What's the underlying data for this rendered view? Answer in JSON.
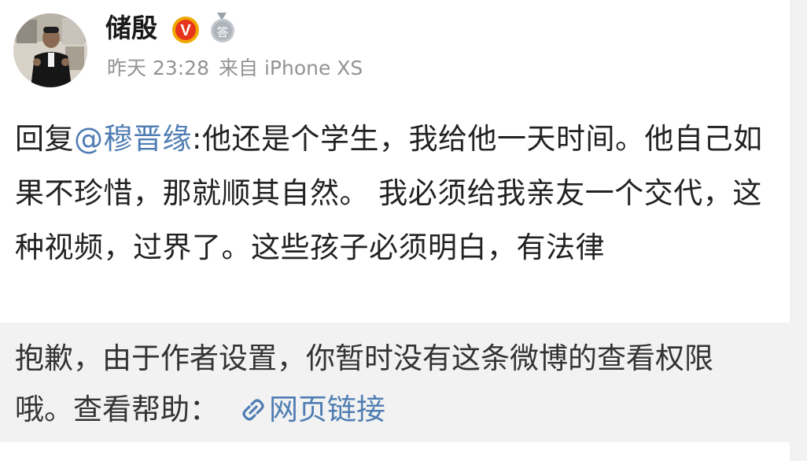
{
  "post": {
    "username": "储殷",
    "time": "昨天 23:28",
    "source": "来自 iPhone XS",
    "reply_prefix": "回复",
    "mention": "@穆晋缘",
    "content": ":他还是个学生，我给他一天时间。他自己如果不珍惜，那就顺其自然。 我必须给我亲友一个交代，这种视频，过界了。这些孩子必须明白，有法律"
  },
  "notice": {
    "text": "抱歉，由于作者设置，你暂时没有这条微博的查看权限哦。查看帮助：",
    "link_label": "网页链接"
  },
  "badges": {
    "verified_letter": "V",
    "medal_char": "答"
  },
  "icons": {
    "verified": "verified-v-icon",
    "medal": "medal-icon",
    "link": "link-icon"
  },
  "colors": {
    "link": "#4f7db3",
    "verified_ring": "#f0a800",
    "verified_fill": "#e8341c",
    "meta_text": "#939393",
    "notice_bg": "#f2f2f2"
  }
}
